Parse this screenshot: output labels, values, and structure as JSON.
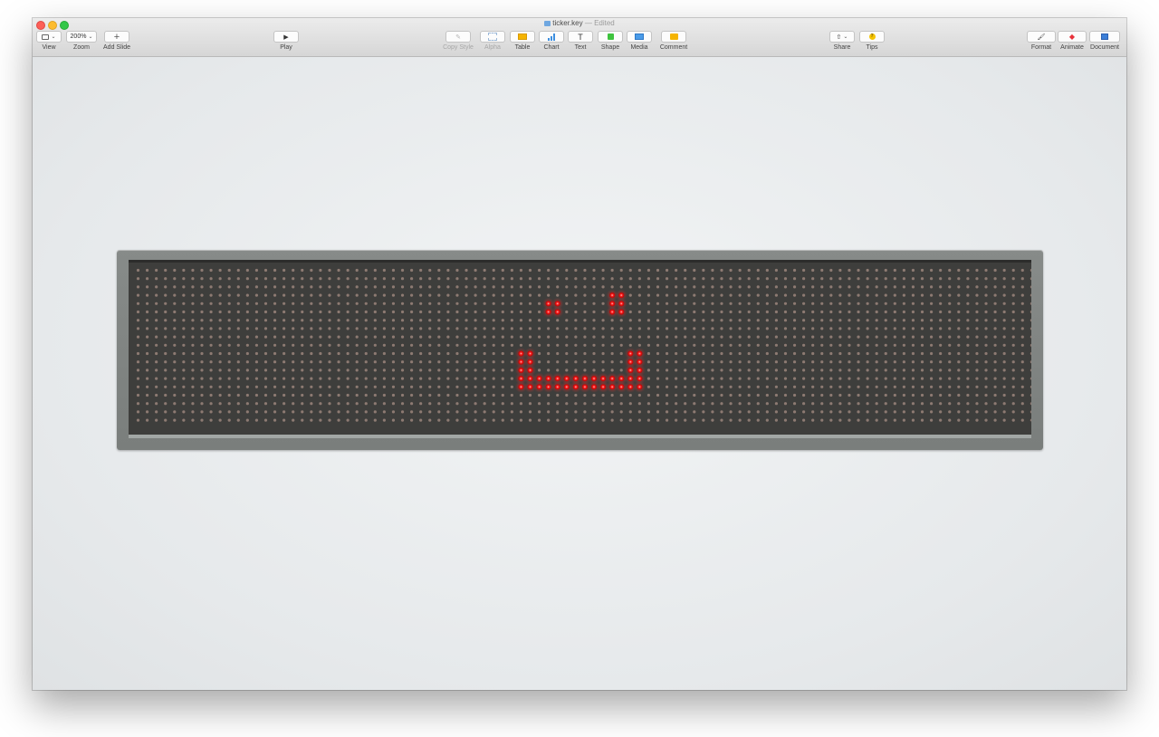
{
  "window": {
    "file_name": "ticker.key",
    "separator": "—",
    "status": "Edited"
  },
  "toolbar": {
    "view": {
      "label": "View",
      "icon": "sidebar-icon"
    },
    "zoom": {
      "label": "Zoom",
      "value": "200%"
    },
    "add_slide": {
      "label": "Add Slide",
      "icon": "plus-icon"
    },
    "play": {
      "label": "Play",
      "icon": "play-icon"
    },
    "copy_style": {
      "label": "Copy Style",
      "icon": "eyedropper-icon"
    },
    "alpha": {
      "label": "Alpha",
      "icon": "alpha-icon"
    },
    "table": {
      "label": "Table",
      "icon": "table-icon",
      "color": "#f5b400"
    },
    "chart": {
      "label": "Chart",
      "icon": "chart-icon",
      "color": "#3d8fe0"
    },
    "text": {
      "label": "Text",
      "icon": "text-icon"
    },
    "shape": {
      "label": "Shape",
      "icon": "shape-icon",
      "color": "#3ec33e"
    },
    "media": {
      "label": "Media",
      "icon": "media-icon",
      "color": "#4a9be8"
    },
    "comment": {
      "label": "Comment",
      "icon": "comment-icon",
      "color": "#f5b400"
    },
    "share": {
      "label": "Share",
      "icon": "share-icon"
    },
    "tips": {
      "label": "Tips",
      "icon": "tips-icon",
      "color": "#f5c400"
    },
    "format": {
      "label": "Format",
      "icon": "paintbrush-icon"
    },
    "animate": {
      "label": "Animate",
      "icon": "animate-icon",
      "color": "#e8313a"
    },
    "document": {
      "label": "Document",
      "icon": "document-icon",
      "color": "#3c7fd8"
    }
  },
  "led_display": {
    "rows": 19,
    "cols": 99,
    "on_color": "#ff2222",
    "off_color": "#8d7a72",
    "lit_cells": [
      [
        3,
        52
      ],
      [
        3,
        53
      ],
      [
        4,
        52
      ],
      [
        4,
        53
      ],
      [
        5,
        52
      ],
      [
        5,
        53
      ],
      [
        4,
        45
      ],
      [
        4,
        46
      ],
      [
        5,
        45
      ],
      [
        5,
        46
      ],
      [
        10,
        42
      ],
      [
        10,
        43
      ],
      [
        10,
        54
      ],
      [
        10,
        55
      ],
      [
        11,
        42
      ],
      [
        11,
        43
      ],
      [
        11,
        54
      ],
      [
        11,
        55
      ],
      [
        12,
        42
      ],
      [
        12,
        43
      ],
      [
        12,
        54
      ],
      [
        12,
        55
      ],
      [
        13,
        42
      ],
      [
        13,
        43
      ],
      [
        13,
        44
      ],
      [
        13,
        45
      ],
      [
        13,
        46
      ],
      [
        13,
        47
      ],
      [
        13,
        48
      ],
      [
        13,
        49
      ],
      [
        13,
        50
      ],
      [
        13,
        51
      ],
      [
        13,
        52
      ],
      [
        13,
        53
      ],
      [
        13,
        54
      ],
      [
        13,
        55
      ],
      [
        14,
        42
      ],
      [
        14,
        43
      ],
      [
        14,
        44
      ],
      [
        14,
        45
      ],
      [
        14,
        46
      ],
      [
        14,
        47
      ],
      [
        14,
        48
      ],
      [
        14,
        49
      ],
      [
        14,
        50
      ],
      [
        14,
        51
      ],
      [
        14,
        52
      ],
      [
        14,
        53
      ],
      [
        14,
        54
      ],
      [
        14,
        55
      ]
    ]
  }
}
